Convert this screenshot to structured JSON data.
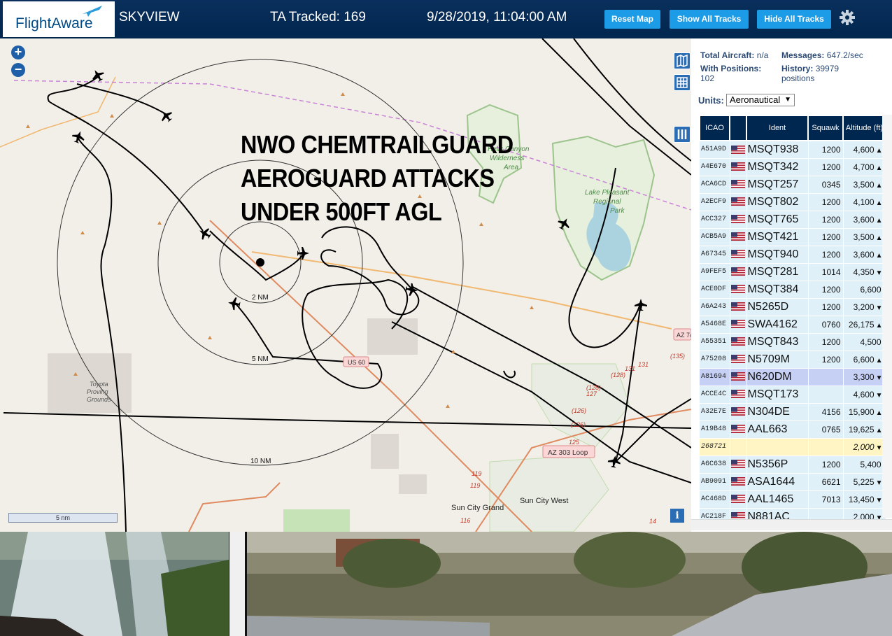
{
  "header": {
    "logo_text": "FlightAware",
    "site_name": "SKYVIEW",
    "tracked_label": "TA Tracked: 169",
    "datetime": "9/28/2019, 11:04:00 AM",
    "buttons": [
      "Reset Map",
      "Show All Tracks",
      "Hide All Tracks"
    ],
    "brand_color": "#00274f",
    "button_color": "#1c9be6"
  },
  "map": {
    "overlay_text": [
      "NWO CHEMTRAILGUARD",
      "AEROGUARD ATTACKS",
      "UNDER 500FT AGL"
    ],
    "range_labels": [
      "2 NM",
      "5 NM",
      "10 NM"
    ],
    "scale_label": "5 nm",
    "place_labels": {
      "wilderness": [
        "Hells Canyon",
        "Wilderness",
        "Area"
      ],
      "lake": [
        "Lake Pleasant",
        "Regional",
        "Park"
      ],
      "proving": [
        "Toyota",
        "Proving",
        "Grounds"
      ],
      "sun_city_grand": "Sun City Grand",
      "sun_city_west": "Sun City West",
      "az_303": "AZ 303 Loop",
      "us_60": "US 60",
      "az_74": "AZ 74"
    },
    "road_numbers": [
      "(135)",
      "131",
      "131",
      "(128)",
      "(128)",
      "127",
      "(126)",
      "(126)",
      "125",
      "119",
      "119",
      "116",
      "14"
    ]
  },
  "panel": {
    "total_aircraft_label": "Total Aircraft:",
    "total_aircraft_value": "n/a",
    "messages_label": "Messages:",
    "messages_value": "647.2/sec",
    "with_positions_label": "With Positions:",
    "with_positions_value": "102",
    "history_label": "History:",
    "history_value": "39979",
    "history_unit": "positions",
    "units_label": "Units:",
    "units_value": "Aeronautical",
    "columns": [
      "ICAO",
      "",
      "Ident",
      "Squawk",
      "Altitude (ft)"
    ],
    "rows": [
      {
        "icao": "A51A9D",
        "ident": "MSQT938",
        "squawk": "1200",
        "alt": "4,600",
        "trend": "▲",
        "flag": true
      },
      {
        "icao": "A4E670",
        "ident": "MSQT342",
        "squawk": "1200",
        "alt": "4,700",
        "trend": "▲",
        "flag": true
      },
      {
        "icao": "ACA6CD",
        "ident": "MSQT257",
        "squawk": "0345",
        "alt": "3,500",
        "trend": "▲",
        "flag": true
      },
      {
        "icao": "A2ECF9",
        "ident": "MSQT802",
        "squawk": "1200",
        "alt": "4,100",
        "trend": "▲",
        "flag": true
      },
      {
        "icao": "ACC327",
        "ident": "MSQT765",
        "squawk": "1200",
        "alt": "3,600",
        "trend": "▲",
        "flag": true
      },
      {
        "icao": "ACB5A9",
        "ident": "MSQT421",
        "squawk": "1200",
        "alt": "3,500",
        "trend": "▲",
        "flag": true
      },
      {
        "icao": "A67345",
        "ident": "MSQT940",
        "squawk": "1200",
        "alt": "3,600",
        "trend": "▲",
        "flag": true
      },
      {
        "icao": "A9FEF5",
        "ident": "MSQT281",
        "squawk": "1014",
        "alt": "4,350",
        "trend": "▼",
        "flag": true
      },
      {
        "icao": "ACE0DF",
        "ident": "MSQT384",
        "squawk": "1200",
        "alt": "6,600",
        "trend": "",
        "flag": true
      },
      {
        "icao": "A6A243",
        "ident": "N5265D",
        "squawk": "1200",
        "alt": "3,200",
        "trend": "▼",
        "flag": true
      },
      {
        "icao": "A5468E",
        "ident": "SWA4162",
        "squawk": "0760",
        "alt": "26,175",
        "trend": "▲",
        "flag": true
      },
      {
        "icao": "A55351",
        "ident": "MSQT843",
        "squawk": "1200",
        "alt": "4,500",
        "trend": "",
        "flag": true
      },
      {
        "icao": "A75208",
        "ident": "N5709M",
        "squawk": "1200",
        "alt": "6,600",
        "trend": "▲",
        "flag": true
      },
      {
        "icao": "A81694",
        "ident": "N620DM",
        "squawk": "",
        "alt": "3,300",
        "trend": "▼",
        "flag": true,
        "selected": true
      },
      {
        "icao": "ACCE4C",
        "ident": "MSQT173",
        "squawk": "",
        "alt": "4,600",
        "trend": "▼",
        "flag": true
      },
      {
        "icao": "A32E7E",
        "ident": "N304DE",
        "squawk": "4156",
        "alt": "15,900",
        "trend": "▲",
        "flag": true
      },
      {
        "icao": "A19B48",
        "ident": "AAL663",
        "squawk": "0765",
        "alt": "19,625",
        "trend": "▲",
        "flag": true
      },
      {
        "icao": "268721",
        "ident": "",
        "squawk": "",
        "alt": "2,000",
        "trend": "▼",
        "flag": false,
        "noid": true
      },
      {
        "icao": "A6C638",
        "ident": "N5356P",
        "squawk": "1200",
        "alt": "5,400",
        "trend": "",
        "flag": true
      },
      {
        "icao": "AB9091",
        "ident": "ASA1644",
        "squawk": "6621",
        "alt": "5,225",
        "trend": "▼",
        "flag": true
      },
      {
        "icao": "AC468D",
        "ident": "AAL1465",
        "squawk": "7013",
        "alt": "13,450",
        "trend": "▼",
        "flag": true
      },
      {
        "icao": "AC218F",
        "ident": "N881AC",
        "squawk": "",
        "alt": "2,000",
        "trend": "▼",
        "flag": true
      }
    ]
  }
}
